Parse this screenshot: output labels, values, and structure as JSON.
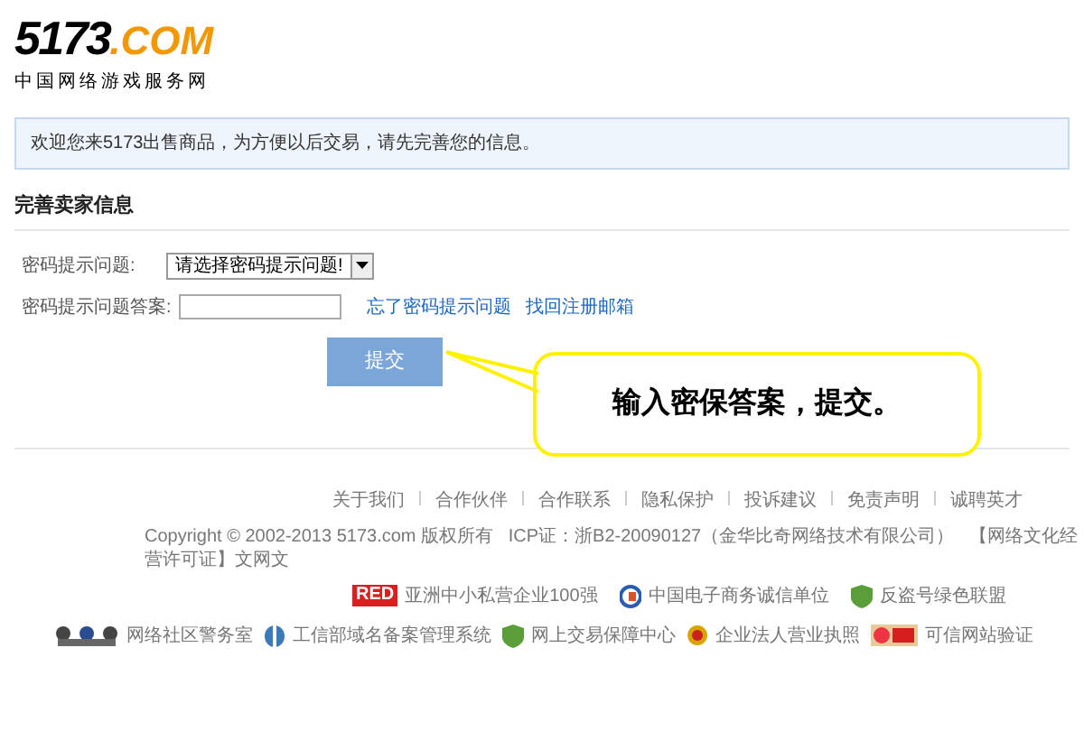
{
  "logo": {
    "brand_dark": "5173",
    "brand_accent": ".COM",
    "tagline": "中国网络游戏服务网"
  },
  "notice": "欢迎您来5173出售商品，为方便以后交易，请先完善您的信息。",
  "section_title": "完善卖家信息",
  "form": {
    "question_label": "密码提示问题:",
    "question_select": "请选择密码提示问题!",
    "answer_label": "密码提示问题答案:",
    "links": [
      "忘了密码提示问题",
      "找回注册邮箱"
    ],
    "submit": "提交"
  },
  "callout": "输入密保答案，提交。",
  "footer": {
    "links": [
      "关于我们",
      "合作伙伴",
      "合作联系",
      "隐私保护",
      "投诉建议",
      "免责声明",
      "诚聘英才"
    ],
    "copyright": "Copyright © 2002-2013 5173.com 版权所有   ICP证：浙B2-20090127（金华比奇网络技术有限公司）   【网络文化经营许可证】文网文",
    "badges_row_1": [
      {
        "kind": "red",
        "label": "亚洲中小私营企业100强",
        "tag": "RED"
      },
      {
        "kind": "c",
        "label": "中国电子商务诚信单位"
      },
      {
        "kind": "shield",
        "label": "反盗号绿色联盟"
      }
    ],
    "badges_row_2": [
      {
        "kind": "police",
        "label": "网络社区警务室"
      },
      {
        "kind": "globe",
        "label": "工信部域名备案管理系统"
      },
      {
        "kind": "shield",
        "label": "网上交易保障中心"
      },
      {
        "kind": "emblem",
        "label": "企业法人营业执照"
      },
      {
        "kind": "trust",
        "label": "可信网站验证"
      }
    ]
  }
}
